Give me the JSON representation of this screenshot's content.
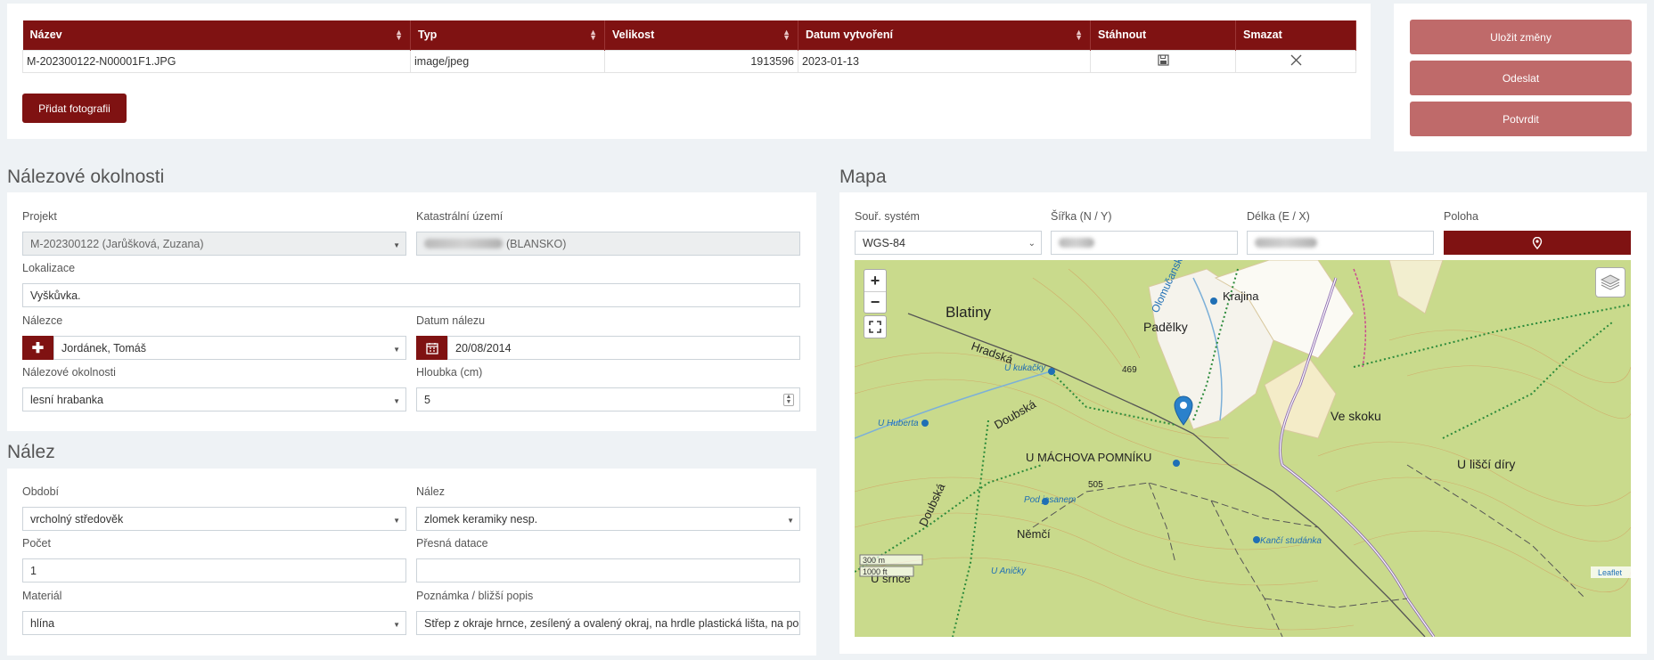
{
  "files": {
    "columns": [
      "Název",
      "Typ",
      "Velikost",
      "Datum vytvoření",
      "Stáhnout",
      "Smazat"
    ],
    "rows": [
      {
        "name": "M-202300122-N00001F1.JPG",
        "type": "image/jpeg",
        "size": "1913596",
        "date": "2023-01-13"
      }
    ],
    "download_icon": "floppy-disk-icon",
    "delete_icon": "close-icon",
    "add_button": "Přidat fotografii"
  },
  "actions": {
    "save": "Uložit změny",
    "send": "Odeslat",
    "confirm": "Potvrdit"
  },
  "circumstances": {
    "title": "Nálezové okolnosti",
    "project_label": "Projekt",
    "project_value": "M-202300122 (Jarůšková, Zuzana)",
    "cadastre_label": "Katastrální území",
    "cadastre_value": "(BLANSKO)",
    "locality_label": "Lokalizace",
    "locality_value": "Vyškůvka.",
    "finder_label": "Nálezce",
    "finder_value": "Jordánek, Tomáš",
    "date_label": "Datum nálezu",
    "date_value": "20/08/2014",
    "conditions_label": "Nálezové okolnosti",
    "conditions_value": "lesní hrabanka",
    "depth_label": "Hloubka (cm)",
    "depth_value": "5"
  },
  "find": {
    "title": "Nález",
    "period_label": "Období",
    "period_value": "vrcholný středověk",
    "find_label": "Nález",
    "find_value": "zlomek keramiky nesp.",
    "count_label": "Počet",
    "count_value": "1",
    "dating_label": "Přesná datace",
    "dating_value": "",
    "material_label": "Materiál",
    "material_value": "hlína",
    "note_label": "Poznámka / bližší popis",
    "note_value": "Střep z okraje hrnce, zesílený a ovalený okraj, na hrdle plastická lišta, na podh"
  },
  "map": {
    "title": "Mapa",
    "crs_label": "Souř. systém",
    "crs_value": "WGS-84",
    "lat_label": "Šířka (N / Y)",
    "lon_label": "Délka (E / X)",
    "position_label": "Poloha",
    "zoom_in": "+",
    "zoom_out": "−",
    "attribution": "Leaflet",
    "scale_m": "300 m",
    "scale_ft": "1000 ft",
    "places": [
      "Blatiny",
      "Hradská",
      "U kukačky",
      "Padělky",
      "Krajina",
      "Olomučanský p.",
      "469",
      "Doubská",
      "U Huberta",
      "Ve skoku",
      "U MÁCHOVA POMNÍKU",
      "505",
      "U liščí díry",
      "Pod jasanem",
      "Němčí",
      "Kančí studánka",
      "Doubská",
      "U Aničky",
      "U srnce"
    ]
  }
}
